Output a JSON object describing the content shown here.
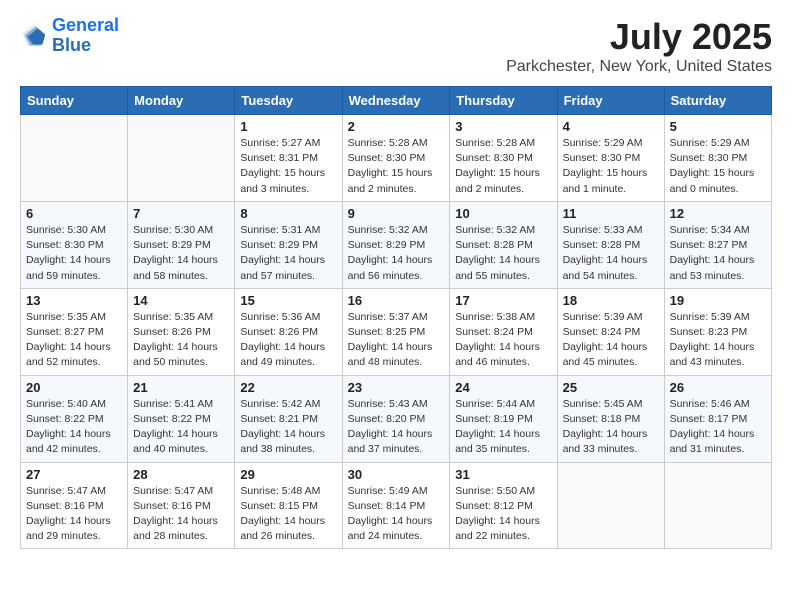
{
  "header": {
    "logo_line1": "General",
    "logo_line2": "Blue",
    "title": "July 2025",
    "subtitle": "Parkchester, New York, United States"
  },
  "days_of_week": [
    "Sunday",
    "Monday",
    "Tuesday",
    "Wednesday",
    "Thursday",
    "Friday",
    "Saturday"
  ],
  "weeks": [
    [
      {
        "day": "",
        "detail": ""
      },
      {
        "day": "",
        "detail": ""
      },
      {
        "day": "1",
        "detail": "Sunrise: 5:27 AM\nSunset: 8:31 PM\nDaylight: 15 hours\nand 3 minutes."
      },
      {
        "day": "2",
        "detail": "Sunrise: 5:28 AM\nSunset: 8:30 PM\nDaylight: 15 hours\nand 2 minutes."
      },
      {
        "day": "3",
        "detail": "Sunrise: 5:28 AM\nSunset: 8:30 PM\nDaylight: 15 hours\nand 2 minutes."
      },
      {
        "day": "4",
        "detail": "Sunrise: 5:29 AM\nSunset: 8:30 PM\nDaylight: 15 hours\nand 1 minute."
      },
      {
        "day": "5",
        "detail": "Sunrise: 5:29 AM\nSunset: 8:30 PM\nDaylight: 15 hours\nand 0 minutes."
      }
    ],
    [
      {
        "day": "6",
        "detail": "Sunrise: 5:30 AM\nSunset: 8:30 PM\nDaylight: 14 hours\nand 59 minutes."
      },
      {
        "day": "7",
        "detail": "Sunrise: 5:30 AM\nSunset: 8:29 PM\nDaylight: 14 hours\nand 58 minutes."
      },
      {
        "day": "8",
        "detail": "Sunrise: 5:31 AM\nSunset: 8:29 PM\nDaylight: 14 hours\nand 57 minutes."
      },
      {
        "day": "9",
        "detail": "Sunrise: 5:32 AM\nSunset: 8:29 PM\nDaylight: 14 hours\nand 56 minutes."
      },
      {
        "day": "10",
        "detail": "Sunrise: 5:32 AM\nSunset: 8:28 PM\nDaylight: 14 hours\nand 55 minutes."
      },
      {
        "day": "11",
        "detail": "Sunrise: 5:33 AM\nSunset: 8:28 PM\nDaylight: 14 hours\nand 54 minutes."
      },
      {
        "day": "12",
        "detail": "Sunrise: 5:34 AM\nSunset: 8:27 PM\nDaylight: 14 hours\nand 53 minutes."
      }
    ],
    [
      {
        "day": "13",
        "detail": "Sunrise: 5:35 AM\nSunset: 8:27 PM\nDaylight: 14 hours\nand 52 minutes."
      },
      {
        "day": "14",
        "detail": "Sunrise: 5:35 AM\nSunset: 8:26 PM\nDaylight: 14 hours\nand 50 minutes."
      },
      {
        "day": "15",
        "detail": "Sunrise: 5:36 AM\nSunset: 8:26 PM\nDaylight: 14 hours\nand 49 minutes."
      },
      {
        "day": "16",
        "detail": "Sunrise: 5:37 AM\nSunset: 8:25 PM\nDaylight: 14 hours\nand 48 minutes."
      },
      {
        "day": "17",
        "detail": "Sunrise: 5:38 AM\nSunset: 8:24 PM\nDaylight: 14 hours\nand 46 minutes."
      },
      {
        "day": "18",
        "detail": "Sunrise: 5:39 AM\nSunset: 8:24 PM\nDaylight: 14 hours\nand 45 minutes."
      },
      {
        "day": "19",
        "detail": "Sunrise: 5:39 AM\nSunset: 8:23 PM\nDaylight: 14 hours\nand 43 minutes."
      }
    ],
    [
      {
        "day": "20",
        "detail": "Sunrise: 5:40 AM\nSunset: 8:22 PM\nDaylight: 14 hours\nand 42 minutes."
      },
      {
        "day": "21",
        "detail": "Sunrise: 5:41 AM\nSunset: 8:22 PM\nDaylight: 14 hours\nand 40 minutes."
      },
      {
        "day": "22",
        "detail": "Sunrise: 5:42 AM\nSunset: 8:21 PM\nDaylight: 14 hours\nand 38 minutes."
      },
      {
        "day": "23",
        "detail": "Sunrise: 5:43 AM\nSunset: 8:20 PM\nDaylight: 14 hours\nand 37 minutes."
      },
      {
        "day": "24",
        "detail": "Sunrise: 5:44 AM\nSunset: 8:19 PM\nDaylight: 14 hours\nand 35 minutes."
      },
      {
        "day": "25",
        "detail": "Sunrise: 5:45 AM\nSunset: 8:18 PM\nDaylight: 14 hours\nand 33 minutes."
      },
      {
        "day": "26",
        "detail": "Sunrise: 5:46 AM\nSunset: 8:17 PM\nDaylight: 14 hours\nand 31 minutes."
      }
    ],
    [
      {
        "day": "27",
        "detail": "Sunrise: 5:47 AM\nSunset: 8:16 PM\nDaylight: 14 hours\nand 29 minutes."
      },
      {
        "day": "28",
        "detail": "Sunrise: 5:47 AM\nSunset: 8:16 PM\nDaylight: 14 hours\nand 28 minutes."
      },
      {
        "day": "29",
        "detail": "Sunrise: 5:48 AM\nSunset: 8:15 PM\nDaylight: 14 hours\nand 26 minutes."
      },
      {
        "day": "30",
        "detail": "Sunrise: 5:49 AM\nSunset: 8:14 PM\nDaylight: 14 hours\nand 24 minutes."
      },
      {
        "day": "31",
        "detail": "Sunrise: 5:50 AM\nSunset: 8:12 PM\nDaylight: 14 hours\nand 22 minutes."
      },
      {
        "day": "",
        "detail": ""
      },
      {
        "day": "",
        "detail": ""
      }
    ]
  ]
}
